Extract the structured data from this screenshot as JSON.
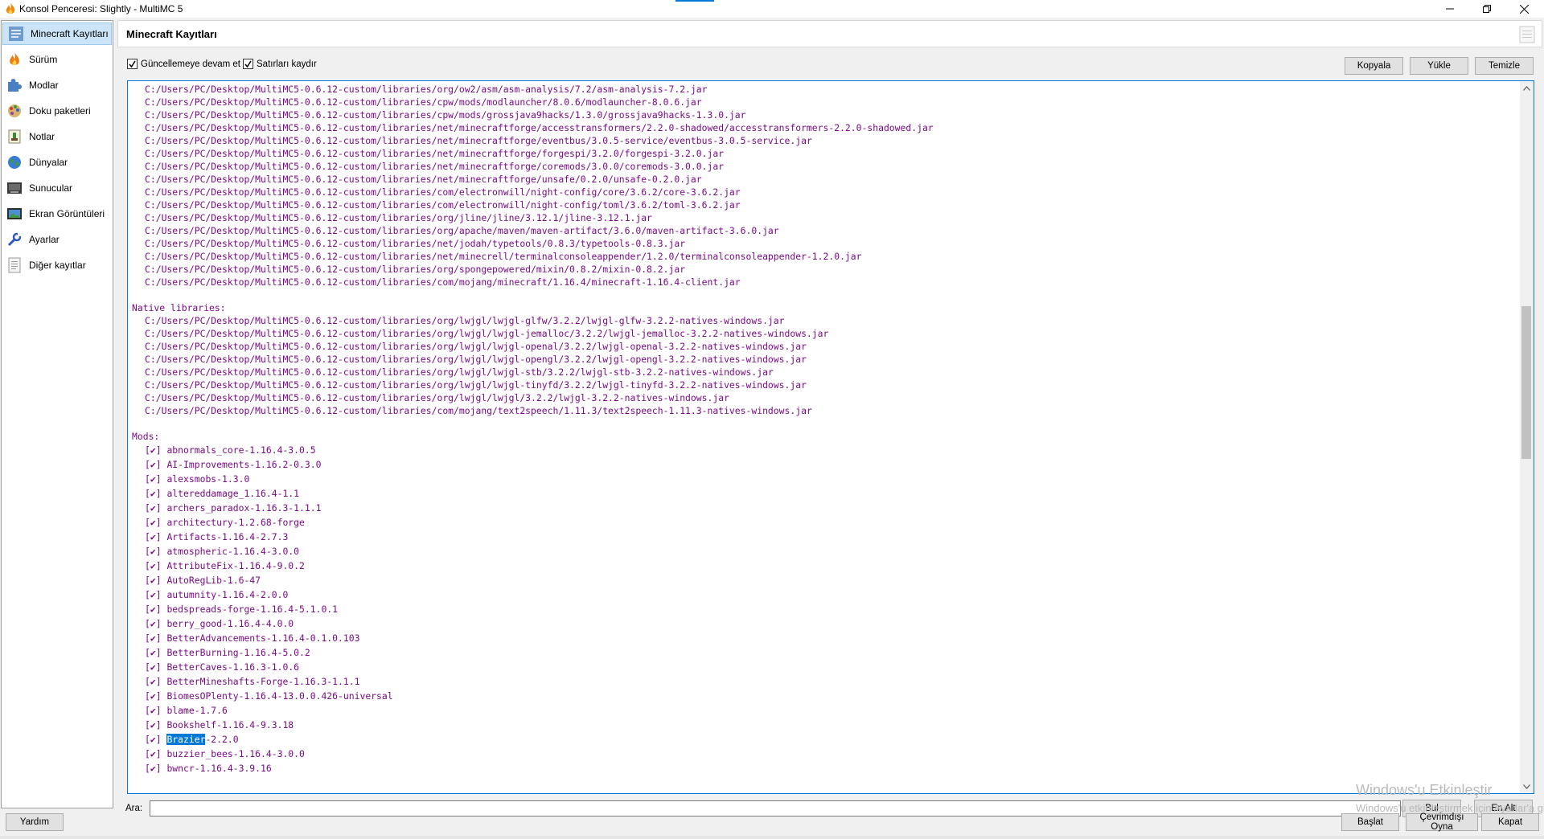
{
  "window": {
    "title": "Konsol Penceresi: Slightly - MultiMC 5",
    "minimize_icon": "minimize-icon",
    "restore_icon": "restore-icon",
    "close_icon": "close-icon"
  },
  "sidebar": {
    "items": [
      {
        "label": "Minecraft Kayıtları",
        "icon": "log-icon",
        "selected": true
      },
      {
        "label": "Sürüm",
        "icon": "flame-icon"
      },
      {
        "label": "Modlar",
        "icon": "puzzle-icon"
      },
      {
        "label": "Doku paketleri",
        "icon": "palette-icon"
      },
      {
        "label": "Notlar",
        "icon": "notes-icon"
      },
      {
        "label": "Dünyalar",
        "icon": "globe-icon"
      },
      {
        "label": "Sunucular",
        "icon": "server-icon"
      },
      {
        "label": "Ekran Görüntüleri",
        "icon": "screenshot-icon"
      },
      {
        "label": "Ayarlar",
        "icon": "wrench-icon"
      },
      {
        "label": "Diğer kayıtlar",
        "icon": "document-icon"
      }
    ]
  },
  "header": {
    "title": "Minecraft Kayıtları"
  },
  "toolbar": {
    "keep_updating": "Güncellemeye devam et",
    "wrap_lines": "Satırları kaydır",
    "copy": "Kopyala",
    "upload": "Yükle",
    "clear": "Temizle"
  },
  "console": {
    "libraries": [
      "C:/Users/PC/Desktop/MultiMC5-0.6.12-custom/libraries/org/ow2/asm/asm-analysis/7.2/asm-analysis-7.2.jar",
      "C:/Users/PC/Desktop/MultiMC5-0.6.12-custom/libraries/cpw/mods/modlauncher/8.0.6/modlauncher-8.0.6.jar",
      "C:/Users/PC/Desktop/MultiMC5-0.6.12-custom/libraries/cpw/mods/grossjava9hacks/1.3.0/grossjava9hacks-1.3.0.jar",
      "C:/Users/PC/Desktop/MultiMC5-0.6.12-custom/libraries/net/minecraftforge/accesstransformers/2.2.0-shadowed/accesstransformers-2.2.0-shadowed.jar",
      "C:/Users/PC/Desktop/MultiMC5-0.6.12-custom/libraries/net/minecraftforge/eventbus/3.0.5-service/eventbus-3.0.5-service.jar",
      "C:/Users/PC/Desktop/MultiMC5-0.6.12-custom/libraries/net/minecraftforge/forgespi/3.2.0/forgespi-3.2.0.jar",
      "C:/Users/PC/Desktop/MultiMC5-0.6.12-custom/libraries/net/minecraftforge/coremods/3.0.0/coremods-3.0.0.jar",
      "C:/Users/PC/Desktop/MultiMC5-0.6.12-custom/libraries/net/minecraftforge/unsafe/0.2.0/unsafe-0.2.0.jar",
      "C:/Users/PC/Desktop/MultiMC5-0.6.12-custom/libraries/com/electronwill/night-config/core/3.6.2/core-3.6.2.jar",
      "C:/Users/PC/Desktop/MultiMC5-0.6.12-custom/libraries/com/electronwill/night-config/toml/3.6.2/toml-3.6.2.jar",
      "C:/Users/PC/Desktop/MultiMC5-0.6.12-custom/libraries/org/jline/jline/3.12.1/jline-3.12.1.jar",
      "C:/Users/PC/Desktop/MultiMC5-0.6.12-custom/libraries/org/apache/maven/maven-artifact/3.6.0/maven-artifact-3.6.0.jar",
      "C:/Users/PC/Desktop/MultiMC5-0.6.12-custom/libraries/net/jodah/typetools/0.8.3/typetools-0.8.3.jar",
      "C:/Users/PC/Desktop/MultiMC5-0.6.12-custom/libraries/net/minecrell/terminalconsoleappender/1.2.0/terminalconsoleappender-1.2.0.jar",
      "C:/Users/PC/Desktop/MultiMC5-0.6.12-custom/libraries/org/spongepowered/mixin/0.8.2/mixin-0.8.2.jar",
      "C:/Users/PC/Desktop/MultiMC5-0.6.12-custom/libraries/com/mojang/minecraft/1.16.4/minecraft-1.16.4-client.jar"
    ],
    "native_header": "Native libraries:",
    "natives": [
      "C:/Users/PC/Desktop/MultiMC5-0.6.12-custom/libraries/org/lwjgl/lwjgl-glfw/3.2.2/lwjgl-glfw-3.2.2-natives-windows.jar",
      "C:/Users/PC/Desktop/MultiMC5-0.6.12-custom/libraries/org/lwjgl/lwjgl-jemalloc/3.2.2/lwjgl-jemalloc-3.2.2-natives-windows.jar",
      "C:/Users/PC/Desktop/MultiMC5-0.6.12-custom/libraries/org/lwjgl/lwjgl-openal/3.2.2/lwjgl-openal-3.2.2-natives-windows.jar",
      "C:/Users/PC/Desktop/MultiMC5-0.6.12-custom/libraries/org/lwjgl/lwjgl-opengl/3.2.2/lwjgl-opengl-3.2.2-natives-windows.jar",
      "C:/Users/PC/Desktop/MultiMC5-0.6.12-custom/libraries/org/lwjgl/lwjgl-stb/3.2.2/lwjgl-stb-3.2.2-natives-windows.jar",
      "C:/Users/PC/Desktop/MultiMC5-0.6.12-custom/libraries/org/lwjgl/lwjgl-tinyfd/3.2.2/lwjgl-tinyfd-3.2.2-natives-windows.jar",
      "C:/Users/PC/Desktop/MultiMC5-0.6.12-custom/libraries/org/lwjgl/lwjgl/3.2.2/lwjgl-3.2.2-natives-windows.jar",
      "C:/Users/PC/Desktop/MultiMC5-0.6.12-custom/libraries/com/mojang/text2speech/1.11.3/text2speech-1.11.3-natives-windows.jar"
    ],
    "mods_header": "Mods:",
    "mod_check": "[✔]",
    "mods": [
      "abnormals_core-1.16.4-3.0.5",
      "AI-Improvements-1.16.2-0.3.0",
      "alexsmobs-1.3.0",
      "altereddamage_1.16.4-1.1",
      "archers_paradox-1.16.3-1.1.1",
      "architectury-1.2.68-forge",
      "Artifacts-1.16.4-2.7.3",
      "atmospheric-1.16.4-3.0.0",
      "AttributeFix-1.16.4-9.0.2",
      "AutoRegLib-1.6-47",
      "autumnity-1.16.4-2.0.0",
      "bedspreads-forge-1.16.4-5.1.0.1",
      "berry_good-1.16.4-4.0.0",
      "BetterAdvancements-1.16.4-0.1.0.103",
      "BetterBurning-1.16.4-5.0.2",
      "BetterCaves-1.16.3-1.0.6",
      "BetterMineshafts-Forge-1.16.3-1.1.1",
      "BiomesOPlenty-1.16.4-13.0.0.426-universal",
      "blame-1.7.6",
      "Bookshelf-1.16.4-9.3.18"
    ],
    "highlight_mod": {
      "selected": "Brazier",
      "rest": "-2.2.0"
    },
    "mods_after": [
      "buzzier_bees-1.16.4-3.0.0",
      "bwncr-1.16.4-3.9.16"
    ]
  },
  "search": {
    "label": "Ara:",
    "find_button": "Bul",
    "bottom_button": "En Alt"
  },
  "watermark": {
    "title": "Windows'u Etkinleştir",
    "subtitle": "Windows'u etkinleştirmek için Ayarlar'a gidin."
  },
  "footer": {
    "help": "Yardım",
    "launch": "Başlat",
    "offline": "Çevrimdışı Oyna",
    "close": "Kapat"
  },
  "colors": {
    "console_text": "#7a0a86",
    "selection": "#0078d7",
    "sidebar_selected": "#cce4f7"
  }
}
